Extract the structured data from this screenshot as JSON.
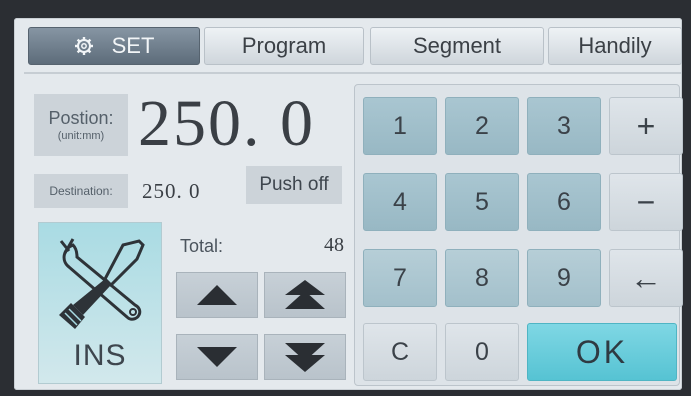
{
  "tabs": {
    "set": "SET",
    "program": "Program",
    "segment": "Segment",
    "handily": "Handily"
  },
  "position": {
    "label": "Postion:",
    "unit": "(unit:mm)",
    "value": "250. 0"
  },
  "destination": {
    "label": "Destination:",
    "value": "250. 0"
  },
  "push_off_label": "Push off",
  "ins_label": "INS",
  "total": {
    "label": "Total:",
    "value": "48"
  },
  "keypad": {
    "k1": "1",
    "k2": "2",
    "k3": "3",
    "plus": "+",
    "k4": "4",
    "k5": "5",
    "k6": "6",
    "minus": "−",
    "k7": "7",
    "k8": "8",
    "k9": "9",
    "backspace": "←",
    "clear": "C",
    "k0": "0",
    "ok": "OK"
  },
  "colors": {
    "active_tab": "#6f7e8c",
    "key_blue": "#a2c1cc",
    "ok_cyan": "#5ec8d7",
    "ins_bg": "#a9dbe3"
  },
  "icons": {
    "set_tab": "gear-icon",
    "ins": "wrench-screwdriver-icon",
    "up": "triangle-up-icon",
    "fast_up": "double-triangle-up-icon",
    "down": "triangle-down-icon",
    "fast_down": "double-triangle-down-icon"
  }
}
